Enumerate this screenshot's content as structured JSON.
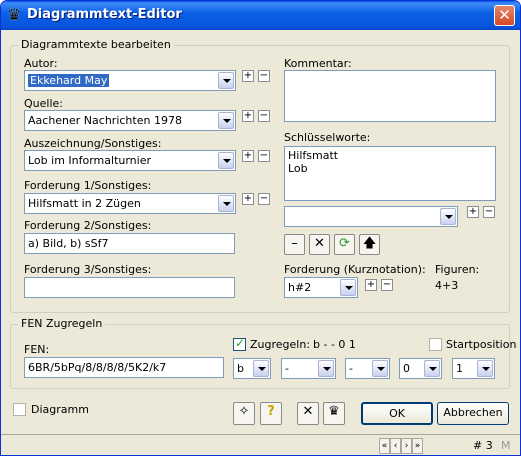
{
  "window": {
    "title": "Diagrammtext-Editor",
    "icon": "chess-queen-icon",
    "close": "✕"
  },
  "edit_group": {
    "legend": "Diagrammtexte bearbeiten",
    "autor": {
      "label": "Autor:",
      "value": "Ekkehard May"
    },
    "quelle": {
      "label": "Quelle:",
      "value": "Aachener Nachrichten 1978"
    },
    "auszeichnung": {
      "label": "Auszeichnung/Sonstiges:",
      "value": "Lob im Informalturnier"
    },
    "forderung1": {
      "label": "Forderung 1/Sonstiges:",
      "value": "Hilfsmatt in 2 Zügen"
    },
    "forderung2": {
      "label": "Forderung 2/Sonstiges:",
      "value": "a) Bild, b) sSf7"
    },
    "forderung3": {
      "label": "Forderung 3/Sonstiges:",
      "value": ""
    },
    "kommentar": {
      "label": "Kommentar:",
      "value": ""
    },
    "schluesselworte": {
      "label": "Schlüsselworte:",
      "lines": [
        "Hilfsmatt",
        "Lob"
      ]
    },
    "keyword_combo": "",
    "forderung_kurz": {
      "label": "Forderung (Kurznotation):",
      "value": "h#2"
    },
    "figuren": {
      "label": "Figuren:",
      "value": "4+3"
    },
    "plus": "+",
    "minus": "−"
  },
  "fen_group": {
    "legend": "FEN Zugregeln",
    "fen": {
      "label": "FEN:",
      "value": "6BR/5bPq/8/8/8/8/5K2/k7"
    },
    "zugregeln": {
      "label": "Zugregeln:",
      "value": "b - - 0 1",
      "checked": true
    },
    "startposition": {
      "label": "Startposition",
      "checked": false
    },
    "combos": [
      "b",
      "-",
      "-",
      "0",
      "1"
    ]
  },
  "footer": {
    "diagramm_label": "Diagramm",
    "ok": "OK",
    "abbrechen": "Abbrechen",
    "record": "# 3",
    "mode": "M",
    "nav": [
      "«",
      "‹",
      "›",
      "»"
    ]
  }
}
